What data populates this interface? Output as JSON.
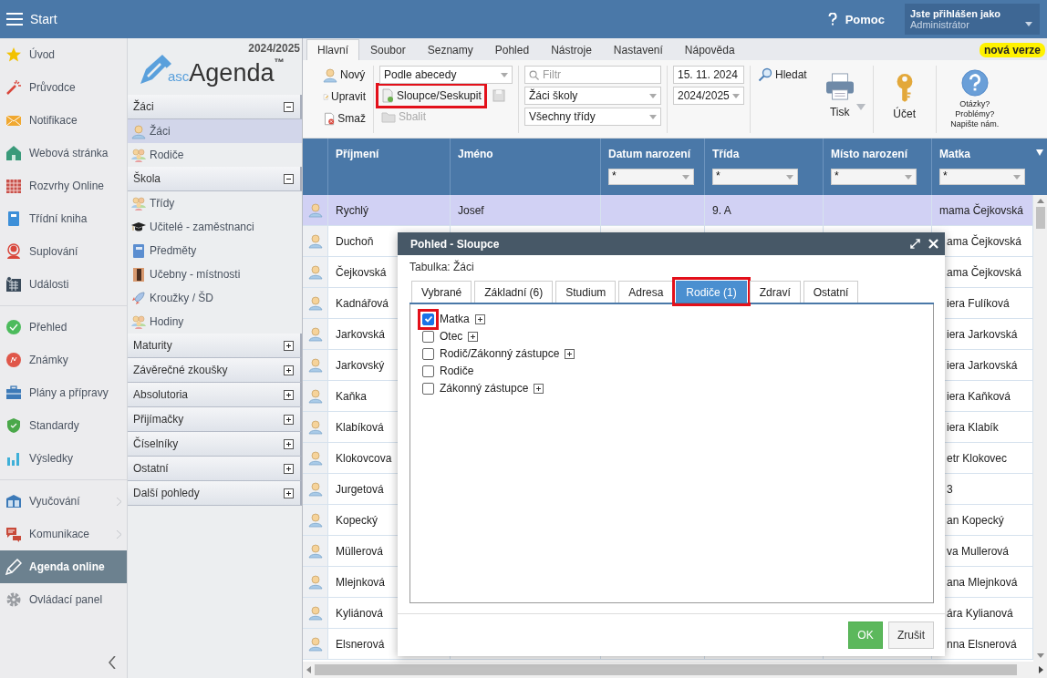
{
  "top_bar": {
    "title": "Start",
    "help": "Pomoc",
    "login_label": "Jste přihlášen jako",
    "user": "Administrátor"
  },
  "nav": {
    "sections": [
      {
        "items": [
          {
            "label": "Úvod",
            "selected": false,
            "has_submenu": false
          },
          {
            "label": "Průvodce",
            "selected": false,
            "has_submenu": false
          },
          {
            "label": "Notifikace",
            "selected": false,
            "has_submenu": false
          },
          {
            "label": "Webová stránka",
            "selected": false,
            "has_submenu": false
          },
          {
            "label": "Rozvrhy Online",
            "selected": false,
            "has_submenu": false
          },
          {
            "label": "Třídní kniha",
            "selected": false,
            "has_submenu": false
          },
          {
            "label": "Suplování",
            "selected": false,
            "has_submenu": false
          },
          {
            "label": "Události",
            "selected": false,
            "has_submenu": false
          }
        ]
      },
      {
        "items": [
          {
            "label": "Přehled",
            "selected": false,
            "has_submenu": false
          },
          {
            "label": "Známky",
            "selected": false,
            "has_submenu": false
          },
          {
            "label": "Plány a přípravy",
            "selected": false,
            "has_submenu": false
          },
          {
            "label": "Standardy",
            "selected": false,
            "has_submenu": false
          },
          {
            "label": "Výsledky",
            "selected": false,
            "has_submenu": false
          }
        ]
      },
      {
        "items": [
          {
            "label": "Vyučování",
            "selected": false,
            "has_submenu": true
          },
          {
            "label": "Komunikace",
            "selected": false,
            "has_submenu": true
          },
          {
            "label": "Agenda online",
            "selected": true,
            "has_submenu": false
          },
          {
            "label": "Ovládací panel",
            "selected": false,
            "has_submenu": false
          }
        ]
      }
    ]
  },
  "panel": {
    "year": "2024/2025",
    "logo": {
      "prefix": "asc",
      "name": "Agenda",
      "mark": "™"
    },
    "groups": [
      {
        "title": "Žáci",
        "expanded": true,
        "items": [
          {
            "label": "Žáci",
            "selected": true
          },
          {
            "label": "Rodiče",
            "selected": false
          }
        ]
      },
      {
        "title": "Škola",
        "expanded": true,
        "items": [
          {
            "label": "Třídy",
            "selected": false
          },
          {
            "label": "Učitelé - zaměstnanci",
            "selected": false
          },
          {
            "label": "Předměty",
            "selected": false
          },
          {
            "label": "Učebny - místnosti",
            "selected": false
          },
          {
            "label": "Kroužky / ŠD",
            "selected": false
          },
          {
            "label": "Hodiny",
            "selected": false
          }
        ]
      },
      {
        "title": "Maturity",
        "expanded": false
      },
      {
        "title": "Závěrečné zkoušky",
        "expanded": false
      },
      {
        "title": "Absolutoria",
        "expanded": false
      },
      {
        "title": "Přijímačky",
        "expanded": false
      },
      {
        "title": "Číselníky",
        "expanded": false
      },
      {
        "title": "Ostatní",
        "expanded": false
      },
      {
        "title": "Další pohledy",
        "expanded": false
      }
    ]
  },
  "ribbon": {
    "tabs": [
      {
        "label": "Hlavní",
        "selected": true
      },
      {
        "label": "Soubor",
        "selected": false
      },
      {
        "label": "Seznamy",
        "selected": false
      },
      {
        "label": "Pohled",
        "selected": false
      },
      {
        "label": "Nástroje",
        "selected": false
      },
      {
        "label": "Nastavení",
        "selected": false
      },
      {
        "label": "Nápověda",
        "selected": false
      }
    ],
    "badge": "nová verze",
    "record_buttons": [
      {
        "label": "Nový"
      },
      {
        "label": "Upravit"
      },
      {
        "label": "Smaž"
      }
    ],
    "sort_select": "Podle abecedy",
    "columns_button": {
      "label": "Sloupce/Seskupit",
      "highlighted": true
    },
    "collapse_button": {
      "label": "Sbalit",
      "disabled": true
    },
    "filter": {
      "placeholder": "Filtr"
    },
    "scope_select": "Žáci školy",
    "class_select": "Všechny třídy",
    "date": "15. 11. 2024",
    "year_select": "2024/2025",
    "search_button": "Hledat",
    "print_button": "Tisk",
    "account_button": "Účet",
    "help_lines": [
      "Otázky?",
      "Problémy?",
      "Napište nám."
    ]
  },
  "table": {
    "columns": [
      {
        "label": "Příjmení"
      },
      {
        "label": "Jméno"
      },
      {
        "label": "Datum narození",
        "filter": "*"
      },
      {
        "label": "Třída",
        "filter": "*"
      },
      {
        "label": "Místo narození",
        "filter": "*"
      },
      {
        "label": "Matka",
        "filter": "*"
      }
    ],
    "rows": [
      {
        "surname": "Rychlý",
        "first_name": "Josef",
        "class": "9. A",
        "mother": "mama Čejkovská",
        "selected": true
      },
      {
        "surname": "Duchoň",
        "mother": "ama Čejkovská",
        "selected": false
      },
      {
        "surname": "Čejkovská",
        "mother": "ama Čejkovská",
        "selected": false
      },
      {
        "surname": "Kadnářová",
        "mother": "iera Fulíková",
        "selected": false
      },
      {
        "surname": "Jarkovská",
        "mother": "iera Jarkovská",
        "selected": false
      },
      {
        "surname": "Jarkovský",
        "mother": "iera Jarkovská",
        "selected": false
      },
      {
        "surname": "Kaňka",
        "mother": "iera Kaňková",
        "selected": false
      },
      {
        "surname": "Klabíková",
        "mother": "iera Klabík",
        "selected": false
      },
      {
        "surname": "Klokovcova",
        "mother": "etr Klokovec",
        "selected": false
      },
      {
        "surname": "Jurgetová",
        "mother": "3",
        "selected": false
      },
      {
        "surname": "Kopecký",
        "mother": "an Kopecký",
        "selected": false
      },
      {
        "surname": "Müllerová",
        "mother": "va Mullerová",
        "selected": false
      },
      {
        "surname": "Mlejnková",
        "mother": "ana Mlejnková",
        "selected": false
      },
      {
        "surname": "Kyliánová",
        "mother": "ára Kylianová",
        "selected": false
      },
      {
        "surname": "Elsnerová",
        "mother": "nna Elsnerová",
        "selected": false
      }
    ]
  },
  "dialog": {
    "title": "Pohled - Sloupce",
    "table_label": "Tabulka: Žáci",
    "tabs": [
      {
        "label": "Vybrané",
        "selected": false,
        "highlighted": false
      },
      {
        "label": "Základní (6)",
        "selected": false,
        "highlighted": false
      },
      {
        "label": "Studium",
        "selected": false,
        "highlighted": false
      },
      {
        "label": "Adresa",
        "selected": false,
        "highlighted": false
      },
      {
        "label": "Rodiče (1)",
        "selected": true,
        "highlighted": true
      },
      {
        "label": "Zdraví",
        "selected": false,
        "highlighted": false
      },
      {
        "label": "Ostatní",
        "selected": false,
        "highlighted": false
      }
    ],
    "fields": [
      {
        "label": "Matka",
        "checked": true,
        "expandable": true,
        "highlighted": true
      },
      {
        "label": "Otec",
        "checked": false,
        "expandable": true,
        "highlighted": false
      },
      {
        "label": "Rodič/Zákonný zástupce",
        "checked": false,
        "expandable": true,
        "highlighted": false
      },
      {
        "label": "Rodiče",
        "checked": false,
        "expandable": false,
        "highlighted": false
      },
      {
        "label": "Zákonný zástupce",
        "checked": false,
        "expandable": true,
        "highlighted": false
      }
    ],
    "ok": "OK",
    "cancel": "Zrušit"
  }
}
